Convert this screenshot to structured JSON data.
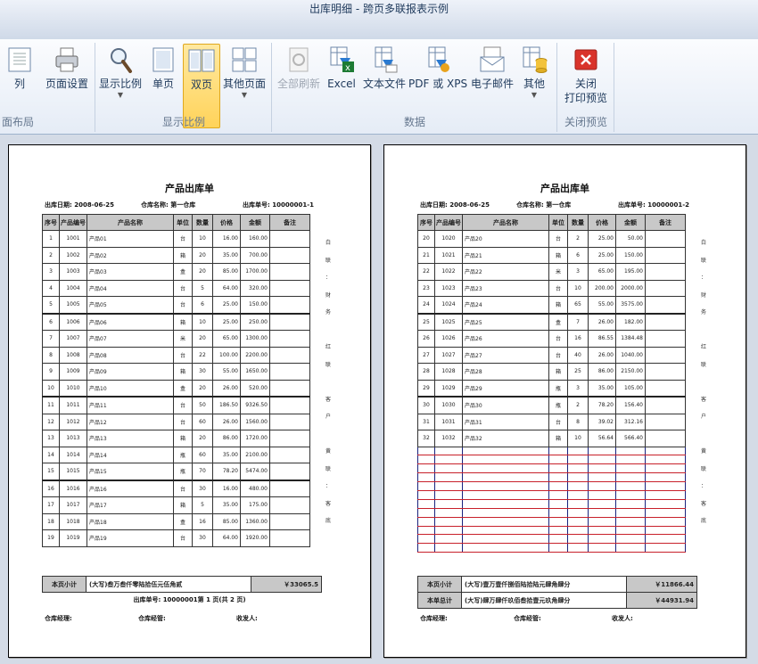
{
  "window": {
    "title": "出库明细 - 跨页多联报表示例"
  },
  "ribbon": {
    "buttons": [
      {
        "id": "col",
        "label": "列"
      },
      {
        "id": "setup",
        "label": "页面设置"
      },
      {
        "id": "zoom",
        "label": "显示比例"
      },
      {
        "id": "single",
        "label": "单页"
      },
      {
        "id": "double",
        "label": "双页"
      },
      {
        "id": "other",
        "label": "其他页面"
      },
      {
        "id": "refresh",
        "label": "全部刷新"
      },
      {
        "id": "excel",
        "label": "Excel"
      },
      {
        "id": "text",
        "label": "文本文件"
      },
      {
        "id": "pdf",
        "label": "PDF 或 XPS"
      },
      {
        "id": "email",
        "label": "电子邮件"
      },
      {
        "id": "more",
        "label": "其他"
      },
      {
        "id": "close",
        "label": "关闭",
        "label2": "打印预览"
      }
    ],
    "groups": {
      "layout": "面布局",
      "zoom": "显示比例",
      "data": "数据",
      "close": "关闭预览"
    }
  },
  "report": {
    "title": "产品出库单",
    "date_label": "出库日期:",
    "date": "2008-06-25",
    "warehouse_label": "仓库名称:",
    "warehouse": "第一仓库",
    "no_label": "出库单号:",
    "columns": [
      "序号",
      "产品编号",
      "产品名称",
      "单位",
      "数量",
      "价格",
      "金额",
      "备注"
    ],
    "page_subtotal_label": "本页小计",
    "grand_total_label": "本单总计",
    "keeper_label": "仓库经理:",
    "handler_label": "仓库经管:",
    "receiver_label": "收发人:"
  },
  "pages": [
    {
      "order_no": "10000001-1",
      "rows": [
        [
          "1",
          "1001",
          "产品01",
          "台",
          "10",
          "16.00",
          "160.00"
        ],
        [
          "2",
          "1002",
          "产品02",
          "箱",
          "20",
          "35.00",
          "700.00"
        ],
        [
          "3",
          "1003",
          "产品03",
          "盒",
          "20",
          "85.00",
          "1700.00"
        ],
        [
          "4",
          "1004",
          "产品04",
          "台",
          "5",
          "64.00",
          "320.00"
        ],
        [
          "5",
          "1005",
          "产品05",
          "台",
          "6",
          "25.00",
          "150.00"
        ],
        [
          "6",
          "1006",
          "产品06",
          "箱",
          "10",
          "25.00",
          "250.00"
        ],
        [
          "7",
          "1007",
          "产品07",
          "米",
          "20",
          "65.00",
          "1300.00"
        ],
        [
          "8",
          "1008",
          "产品08",
          "台",
          "22",
          "100.00",
          "2200.00"
        ],
        [
          "9",
          "1009",
          "产品09",
          "箱",
          "30",
          "55.00",
          "1650.00"
        ],
        [
          "10",
          "1010",
          "产品10",
          "盒",
          "20",
          "26.00",
          "520.00"
        ],
        [
          "11",
          "1011",
          "产品11",
          "台",
          "50",
          "186.50",
          "9326.50"
        ],
        [
          "12",
          "1012",
          "产品12",
          "台",
          "60",
          "26.00",
          "1560.00"
        ],
        [
          "13",
          "1013",
          "产品13",
          "箱",
          "20",
          "86.00",
          "1720.00"
        ],
        [
          "14",
          "1014",
          "产品14",
          "瓶",
          "60",
          "35.00",
          "2100.00"
        ],
        [
          "15",
          "1015",
          "产品15",
          "瓶",
          "70",
          "78.20",
          "5474.00"
        ],
        [
          "16",
          "1016",
          "产品16",
          "台",
          "30",
          "16.00",
          "480.00"
        ],
        [
          "17",
          "1017",
          "产品17",
          "箱",
          "5",
          "35.00",
          "175.00"
        ],
        [
          "18",
          "1018",
          "产品18",
          "盒",
          "16",
          "85.00",
          "1360.00"
        ],
        [
          "19",
          "1019",
          "产品19",
          "台",
          "30",
          "64.00",
          "1920.00"
        ]
      ],
      "blank_rows": 0,
      "subtotal_words": "(大写)叁万叁仟零陆拾伍元伍角贰",
      "subtotal": "￥33065.5",
      "page_line": "出库单号: 10000001第 1 页(共 2 页)",
      "side_text": [
        "白",
        "联",
        "：",
        "财",
        "务",
        "",
        "红",
        "联",
        "",
        "客",
        "户",
        "",
        "黄",
        "联",
        "：",
        "客",
        "底"
      ]
    },
    {
      "order_no": "10000001-2",
      "rows": [
        [
          "20",
          "1020",
          "产品20",
          "台",
          "2",
          "25.00",
          "50.00"
        ],
        [
          "21",
          "1021",
          "产品21",
          "箱",
          "6",
          "25.00",
          "150.00"
        ],
        [
          "22",
          "1022",
          "产品22",
          "米",
          "3",
          "65.00",
          "195.00"
        ],
        [
          "23",
          "1023",
          "产品23",
          "台",
          "10",
          "200.00",
          "2000.00"
        ],
        [
          "24",
          "1024",
          "产品24",
          "箱",
          "65",
          "55.00",
          "3575.00"
        ],
        [
          "25",
          "1025",
          "产品25",
          "盒",
          "7",
          "26.00",
          "182.00"
        ],
        [
          "26",
          "1026",
          "产品26",
          "台",
          "16",
          "86.55",
          "1384.48"
        ],
        [
          "27",
          "1027",
          "产品27",
          "台",
          "40",
          "26.00",
          "1040.00"
        ],
        [
          "28",
          "1028",
          "产品28",
          "箱",
          "25",
          "86.00",
          "2150.00"
        ],
        [
          "29",
          "1029",
          "产品29",
          "瓶",
          "3",
          "35.00",
          "105.00"
        ],
        [
          "30",
          "1030",
          "产品30",
          "瓶",
          "2",
          "78.20",
          "156.40"
        ],
        [
          "31",
          "1031",
          "产品31",
          "台",
          "8",
          "39.02",
          "312.16"
        ],
        [
          "32",
          "1032",
          "产品32",
          "箱",
          "10",
          "56.64",
          "566.40"
        ]
      ],
      "blank_rows": 12,
      "subtotal_words": "(大写)壹万壹仟捌佰陆拾陆元肆角肆分",
      "subtotal": "￥11866.44",
      "total_words": "(大写)肆万肆仟玖佰叁拾壹元玖角肆分",
      "total": "￥44931.94",
      "side_text": [
        "白",
        "联",
        "：",
        "财",
        "务",
        "",
        "红",
        "联",
        "",
        "客",
        "户",
        "",
        "黄",
        "联",
        "：",
        "客",
        "底"
      ]
    }
  ]
}
